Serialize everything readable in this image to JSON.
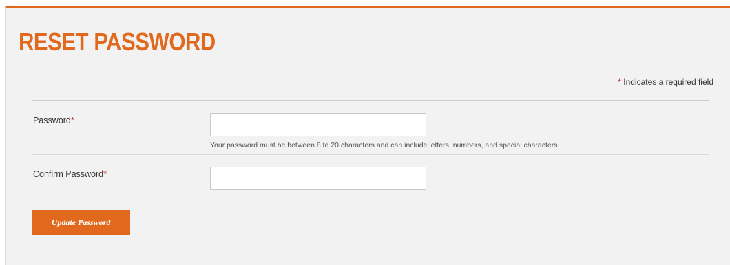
{
  "page": {
    "title": "RESET PASSWORD",
    "required_star": "*",
    "required_note": " Indicates a required field"
  },
  "form": {
    "password": {
      "label": "Password",
      "required_mark": "*",
      "value": "",
      "hint": "Your password must be between 8 to 20 characters and can include letters, numbers, and special characters."
    },
    "confirm_password": {
      "label": "Confirm Password",
      "required_mark": "*",
      "value": ""
    },
    "submit_label": "Update Password"
  },
  "colors": {
    "accent": "#e0691e",
    "required": "#d61f1f",
    "panel_bg": "#f2f2f2"
  }
}
